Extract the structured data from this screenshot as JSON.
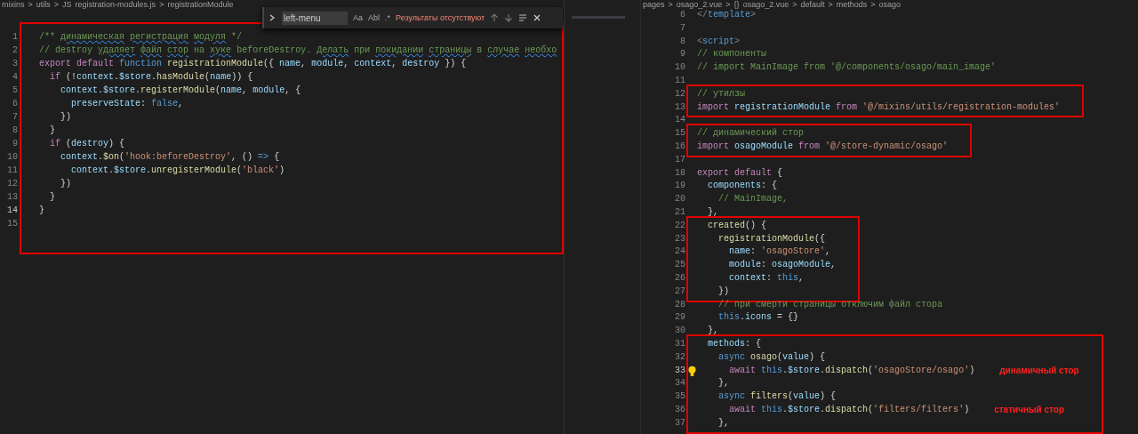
{
  "left_pane": {
    "breadcrumbs": [
      "mixins",
      ">",
      "utils",
      ">",
      "JS",
      "registration-modules.js",
      ">",
      "registrationModule"
    ],
    "find_widget": {
      "value": "left-menu",
      "options": [
        "Aa",
        "Abl",
        ".*"
      ],
      "result": "Результаты отсутствуют"
    },
    "blocks": [
      {
        "boxed": true,
        "lines": [
          {
            "n": "1",
            "cur": false,
            "t": [
              {
                "kind": "c",
                "text": "/** "
              },
              {
                "kind": "cs",
                "text": "динамическая"
              },
              {
                "kind": "cs",
                "text": " регистрация"
              },
              {
                "kind": "cs",
                "text": " модуля"
              },
              {
                "kind": "c",
                "text": " */"
              }
            ]
          },
          {
            "n": "2",
            "cur": false,
            "t": [
              {
                "kind": "c",
                "text": "// destroy "
              },
              {
                "kind": "cs",
                "text": "удаляет"
              },
              {
                "kind": "cs",
                "text": " файл"
              },
              {
                "kind": "cs",
                "text": " стор"
              },
              {
                "kind": "c",
                "text": " на "
              },
              {
                "kind": "cs",
                "text": "хуке"
              },
              {
                "kind": "c",
                "text": " beforeDestroy. "
              },
              {
                "kind": "cs",
                "text": "Делать"
              },
              {
                "kind": "c",
                "text": " при "
              },
              {
                "kind": "cs",
                "text": "покидании"
              },
              {
                "kind": "cs",
                "text": " страницы"
              },
              {
                "kind": "c",
                "text": " в "
              },
              {
                "kind": "cs",
                "text": "случае"
              },
              {
                "kind": "cs",
                "text": " необхо"
              }
            ]
          },
          {
            "n": "3",
            "cur": false,
            "t": [
              {
                "kind": "k",
                "text": "export "
              },
              {
                "kind": "k",
                "text": "default "
              },
              {
                "kind": "b",
                "text": "function "
              },
              {
                "kind": "f",
                "text": "registrationModule"
              },
              {
                "kind": "p",
                "text": "({ "
              },
              {
                "kind": "v",
                "text": "name"
              },
              {
                "kind": "p",
                "text": ", "
              },
              {
                "kind": "v",
                "text": "module"
              },
              {
                "kind": "p",
                "text": ", "
              },
              {
                "kind": "v",
                "text": "context"
              },
              {
                "kind": "p",
                "text": ", "
              },
              {
                "kind": "v",
                "text": "destroy"
              },
              {
                "kind": "p",
                "text": " }) {"
              }
            ]
          },
          {
            "n": "4",
            "cur": false,
            "t": [
              {
                "kind": "k",
                "text": "  if"
              },
              {
                "kind": "p",
                "text": " (!"
              },
              {
                "kind": "v",
                "text": "context"
              },
              {
                "kind": "p",
                "text": "."
              },
              {
                "kind": "v",
                "text": "$store"
              },
              {
                "kind": "p",
                "text": "."
              },
              {
                "kind": "f",
                "text": "hasModule"
              },
              {
                "kind": "p",
                "text": "("
              },
              {
                "kind": "v",
                "text": "name"
              },
              {
                "kind": "p",
                "text": ")) {"
              }
            ]
          },
          {
            "n": "5",
            "cur": false,
            "t": [
              {
                "kind": "v",
                "text": "    context"
              },
              {
                "kind": "p",
                "text": "."
              },
              {
                "kind": "v",
                "text": "$store"
              },
              {
                "kind": "p",
                "text": "."
              },
              {
                "kind": "f",
                "text": "registerModule"
              },
              {
                "kind": "p",
                "text": "("
              },
              {
                "kind": "v",
                "text": "name"
              },
              {
                "kind": "p",
                "text": ", "
              },
              {
                "kind": "v",
                "text": "module"
              },
              {
                "kind": "p",
                "text": ", {"
              }
            ]
          },
          {
            "n": "6",
            "cur": false,
            "t": [
              {
                "kind": "v",
                "text": "      preserveState"
              },
              {
                "kind": "p",
                "text": ": "
              },
              {
                "kind": "b",
                "text": "false"
              },
              {
                "kind": "p",
                "text": ","
              }
            ]
          },
          {
            "n": "7",
            "cur": false,
            "t": [
              {
                "kind": "p",
                "text": "    })"
              }
            ]
          },
          {
            "n": "8",
            "cur": false,
            "t": [
              {
                "kind": "p",
                "text": "  }"
              }
            ]
          },
          {
            "n": "9",
            "cur": false,
            "t": [
              {
                "kind": "k",
                "text": "  if"
              },
              {
                "kind": "p",
                "text": " ("
              },
              {
                "kind": "v",
                "text": "destroy"
              },
              {
                "kind": "p",
                "text": ") {"
              }
            ]
          },
          {
            "n": "10",
            "cur": false,
            "t": [
              {
                "kind": "v",
                "text": "    context"
              },
              {
                "kind": "p",
                "text": "."
              },
              {
                "kind": "f",
                "text": "$on"
              },
              {
                "kind": "p",
                "text": "("
              },
              {
                "kind": "s",
                "text": "'hook:beforeDestroy'"
              },
              {
                "kind": "p",
                "text": ", () "
              },
              {
                "kind": "b",
                "text": "=>"
              },
              {
                "kind": "p",
                "text": " {"
              }
            ]
          },
          {
            "n": "11",
            "cur": false,
            "t": [
              {
                "kind": "v",
                "text": "      context"
              },
              {
                "kind": "p",
                "text": "."
              },
              {
                "kind": "v",
                "text": "$store"
              },
              {
                "kind": "p",
                "text": "."
              },
              {
                "kind": "f",
                "text": "unregisterModule"
              },
              {
                "kind": "p",
                "text": "("
              },
              {
                "kind": "s",
                "text": "'black'"
              },
              {
                "kind": "p",
                "text": ")"
              }
            ]
          },
          {
            "n": "12",
            "cur": false,
            "t": [
              {
                "kind": "p",
                "text": "    })"
              }
            ]
          },
          {
            "n": "13",
            "cur": false,
            "t": [
              {
                "kind": "p",
                "text": "  }"
              }
            ]
          },
          {
            "n": "14",
            "cur": true,
            "t": [
              {
                "kind": "p",
                "text": "}"
              }
            ]
          },
          {
            "n": "15",
            "cur": false
          }
        ]
      }
    ]
  },
  "right_pane": {
    "breadcrumbs": [
      "pages",
      ">",
      "osago_2.vue",
      ">",
      "{}",
      "osago_2.vue",
      ">",
      "default",
      ">",
      "methods",
      ">",
      "osago"
    ],
    "lightbulb": true,
    "blocks": [
      {
        "boxed": false,
        "lines": [
          {
            "n": "6",
            "cur": false,
            "t": [
              {
                "kind": "t",
                "text": "</"
              },
              {
                "kind": "b",
                "text": "template"
              },
              {
                "kind": "t",
                "text": ">"
              }
            ]
          },
          {
            "n": "7",
            "cur": false
          },
          {
            "n": "8",
            "cur": false,
            "t": [
              {
                "kind": "t",
                "text": "<"
              },
              {
                "kind": "b",
                "text": "script"
              },
              {
                "kind": "t",
                "text": ">"
              }
            ]
          },
          {
            "n": "9",
            "cur": false,
            "t": [
              {
                "kind": "c",
                "text": "// компоненты"
              }
            ]
          },
          {
            "n": "10",
            "cur": false,
            "t": [
              {
                "kind": "c",
                "text": "// import MainImage from '@/components/osago/main_image'"
              }
            ]
          },
          {
            "n": "11",
            "cur": false
          }
        ]
      },
      {
        "boxed": true,
        "lines": [
          {
            "n": "12",
            "cur": false,
            "t": [
              {
                "kind": "c",
                "text": "// утилзы"
              }
            ]
          },
          {
            "n": "13",
            "cur": false,
            "t": [
              {
                "kind": "k",
                "text": "import "
              },
              {
                "kind": "v",
                "text": "registrationModule "
              },
              {
                "kind": "k",
                "text": "from "
              },
              {
                "kind": "s",
                "text": "'@/mixins/utils/registration-modules'"
              }
            ]
          }
        ]
      },
      {
        "boxed": false,
        "lines": [
          {
            "n": "14",
            "cur": false
          }
        ]
      },
      {
        "boxed": true,
        "lines": [
          {
            "n": "15",
            "cur": false,
            "t": [
              {
                "kind": "c",
                "text": "// динамический стор"
              }
            ]
          },
          {
            "n": "16",
            "cur": false,
            "t": [
              {
                "kind": "k",
                "text": "import "
              },
              {
                "kind": "v",
                "text": "osagoModule "
              },
              {
                "kind": "k",
                "text": "from "
              },
              {
                "kind": "s",
                "text": "'@/store-dynamic/osago'"
              }
            ]
          }
        ]
      },
      {
        "boxed": false,
        "lines": [
          {
            "n": "17",
            "cur": false
          },
          {
            "n": "18",
            "cur": false,
            "t": [
              {
                "kind": "k",
                "text": "export "
              },
              {
                "kind": "k",
                "text": "default"
              },
              {
                "kind": "p",
                "text": " {"
              }
            ]
          },
          {
            "n": "19",
            "cur": false,
            "t": [
              {
                "kind": "v",
                "text": "  components"
              },
              {
                "kind": "p",
                "text": ": {"
              }
            ]
          },
          {
            "n": "20",
            "cur": false,
            "t": [
              {
                "kind": "c",
                "text": "    // MainImage,"
              }
            ]
          },
          {
            "n": "21",
            "cur": false,
            "t": [
              {
                "kind": "p",
                "text": "  },"
              }
            ]
          }
        ]
      },
      {
        "boxed": true,
        "lines": [
          {
            "n": "22",
            "cur": false,
            "t": [
              {
                "kind": "f",
                "text": "  created"
              },
              {
                "kind": "p",
                "text": "() {"
              }
            ]
          },
          {
            "n": "23",
            "cur": false,
            "t": [
              {
                "kind": "f",
                "text": "    registrationModule"
              },
              {
                "kind": "p",
                "text": "({"
              }
            ]
          },
          {
            "n": "24",
            "cur": false,
            "t": [
              {
                "kind": "v",
                "text": "      name"
              },
              {
                "kind": "p",
                "text": ": "
              },
              {
                "kind": "s",
                "text": "'osagoStore'"
              },
              {
                "kind": "p",
                "text": ","
              }
            ]
          },
          {
            "n": "25",
            "cur": false,
            "t": [
              {
                "kind": "v",
                "text": "      module"
              },
              {
                "kind": "p",
                "text": ": "
              },
              {
                "kind": "v",
                "text": "osagoModule"
              },
              {
                "kind": "p",
                "text": ","
              }
            ]
          },
          {
            "n": "26",
            "cur": false,
            "t": [
              {
                "kind": "v",
                "text": "      context"
              },
              {
                "kind": "p",
                "text": ": "
              },
              {
                "kind": "b",
                "text": "this"
              },
              {
                "kind": "p",
                "text": ","
              }
            ]
          },
          {
            "n": "27",
            "cur": false,
            "t": [
              {
                "kind": "p",
                "text": "    })"
              }
            ]
          }
        ]
      },
      {
        "boxed": false,
        "lines": [
          {
            "n": "28",
            "cur": false,
            "t": [
              {
                "kind": "c",
                "text": "    // при смерти страницы отключим файл стора"
              }
            ]
          },
          {
            "n": "29",
            "cur": false,
            "t": [
              {
                "kind": "b",
                "text": "    this"
              },
              {
                "kind": "p",
                "text": "."
              },
              {
                "kind": "v",
                "text": "icons"
              },
              {
                "kind": "p",
                "text": " = {}"
              }
            ]
          },
          {
            "n": "30",
            "cur": false,
            "t": [
              {
                "kind": "p",
                "text": "  },"
              }
            ]
          }
        ]
      },
      {
        "boxed": true,
        "lines": [
          {
            "n": "31",
            "cur": false,
            "t": [
              {
                "kind": "v",
                "text": "  methods"
              },
              {
                "kind": "p",
                "text": ": {"
              }
            ]
          },
          {
            "n": "32",
            "cur": false,
            "t": [
              {
                "kind": "b",
                "text": "    async "
              },
              {
                "kind": "f",
                "text": "osago"
              },
              {
                "kind": "p",
                "text": "("
              },
              {
                "kind": "v",
                "text": "value"
              },
              {
                "kind": "p",
                "text": ") {"
              }
            ]
          },
          {
            "n": "33",
            "cur": true,
            "t": [
              {
                "kind": "k",
                "text": "      await "
              },
              {
                "kind": "b",
                "text": "this"
              },
              {
                "kind": "p",
                "text": "."
              },
              {
                "kind": "v",
                "text": "$store"
              },
              {
                "kind": "p",
                "text": "."
              },
              {
                "kind": "f",
                "text": "dispatch"
              },
              {
                "kind": "p",
                "text": "("
              },
              {
                "kind": "s",
                "text": "'osagoStore/osago'"
              },
              {
                "kind": "p",
                "text": ")"
              },
              {
                "kind": "n",
                "text": "динамичный стор"
              }
            ]
          },
          {
            "n": "34",
            "cur": false,
            "t": [
              {
                "kind": "p",
                "text": "    },"
              }
            ]
          },
          {
            "n": "35",
            "cur": false,
            "t": [
              {
                "kind": "b",
                "text": "    async "
              },
              {
                "kind": "f",
                "text": "filters"
              },
              {
                "kind": "p",
                "text": "("
              },
              {
                "kind": "v",
                "text": "value"
              },
              {
                "kind": "p",
                "text": ") {"
              }
            ]
          },
          {
            "n": "36",
            "cur": false,
            "t": [
              {
                "kind": "k",
                "text": "      await "
              },
              {
                "kind": "b",
                "text": "this"
              },
              {
                "kind": "p",
                "text": "."
              },
              {
                "kind": "v",
                "text": "$store"
              },
              {
                "kind": "p",
                "text": "."
              },
              {
                "kind": "f",
                "text": "dispatch"
              },
              {
                "kind": "p",
                "text": "("
              },
              {
                "kind": "s",
                "text": "'filters/filters'"
              },
              {
                "kind": "p",
                "text": ")"
              },
              {
                "kind": "n",
                "text": "статичный стор"
              }
            ]
          },
          {
            "n": "37",
            "cur": false,
            "t": [
              {
                "kind": "p",
                "text": "    },"
              }
            ]
          }
        ]
      }
    ]
  }
}
